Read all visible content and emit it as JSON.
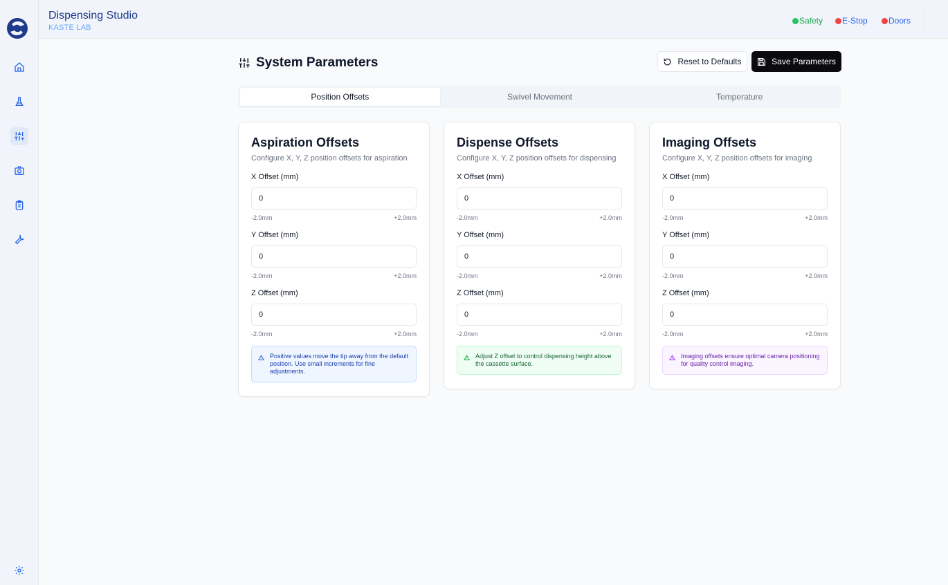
{
  "app": {
    "title": "Dispensing Studio",
    "subtitle": "KASTE LAB"
  },
  "status": [
    {
      "label": "Safety",
      "color": "#22c55e"
    },
    {
      "label": "E-Stop",
      "color": "#ef4444"
    },
    {
      "label": "Doors",
      "color": "#ef4444"
    }
  ],
  "sidebar": {
    "items": [
      {
        "icon": "home-icon"
      },
      {
        "icon": "flask-icon"
      },
      {
        "icon": "sliders-icon",
        "active": true
      },
      {
        "icon": "camera-icon"
      },
      {
        "icon": "clipboard-icon"
      },
      {
        "icon": "wrench-icon"
      }
    ],
    "bottom": {
      "icon": "gear-icon"
    }
  },
  "page": {
    "title": "System Parameters",
    "title_icon": "sliders-icon"
  },
  "actions": {
    "reset_label": "Reset to Defaults",
    "save_label": "Save Parameters"
  },
  "tabs": [
    {
      "label": "Position Offsets",
      "active": true
    },
    {
      "label": "Swivel Movement"
    },
    {
      "label": "Temperature"
    }
  ],
  "cards": [
    {
      "title": "Aspiration Offsets",
      "description": "Configure X, Y, Z position offsets for aspiration",
      "fields": [
        {
          "label": "X Offset (mm)",
          "value": "0",
          "min": "-2.0mm",
          "max": "+2.0mm"
        },
        {
          "label": "Y Offset (mm)",
          "value": "0",
          "min": "-2.0mm",
          "max": "+2.0mm"
        },
        {
          "label": "Z Offset (mm)",
          "value": "0",
          "min": "-2.0mm",
          "max": "+2.0mm"
        }
      ],
      "note": "Positive values move the tip away from the default position. Use small increments for fine adjustments.",
      "note_color": "blue"
    },
    {
      "title": "Dispense Offsets",
      "description": "Configure X, Y, Z position offsets for dispensing",
      "fields": [
        {
          "label": "X Offset (mm)",
          "value": "0",
          "min": "-2.0mm",
          "max": "+2.0mm"
        },
        {
          "label": "Y Offset (mm)",
          "value": "0",
          "min": "-2.0mm",
          "max": "+2.0mm"
        },
        {
          "label": "Z Offset (mm)",
          "value": "0",
          "min": "-2.0mm",
          "max": "+2.0mm"
        }
      ],
      "note": "Adjust Z offset to control dispensing height above the cassette surface.",
      "note_color": "green"
    },
    {
      "title": "Imaging Offsets",
      "description": "Configure X, Y, Z position offsets for imaging",
      "fields": [
        {
          "label": "X Offset (mm)",
          "value": "0",
          "min": "-2.0mm",
          "max": "+2.0mm"
        },
        {
          "label": "Y Offset (mm)",
          "value": "0",
          "min": "-2.0mm",
          "max": "+2.0mm"
        },
        {
          "label": "Z Offset (mm)",
          "value": "0",
          "min": "-2.0mm",
          "max": "+2.0mm"
        }
      ],
      "note": "Imaging offsets ensure optimal camera positioning for quality control imaging.",
      "note_color": "purple"
    }
  ]
}
